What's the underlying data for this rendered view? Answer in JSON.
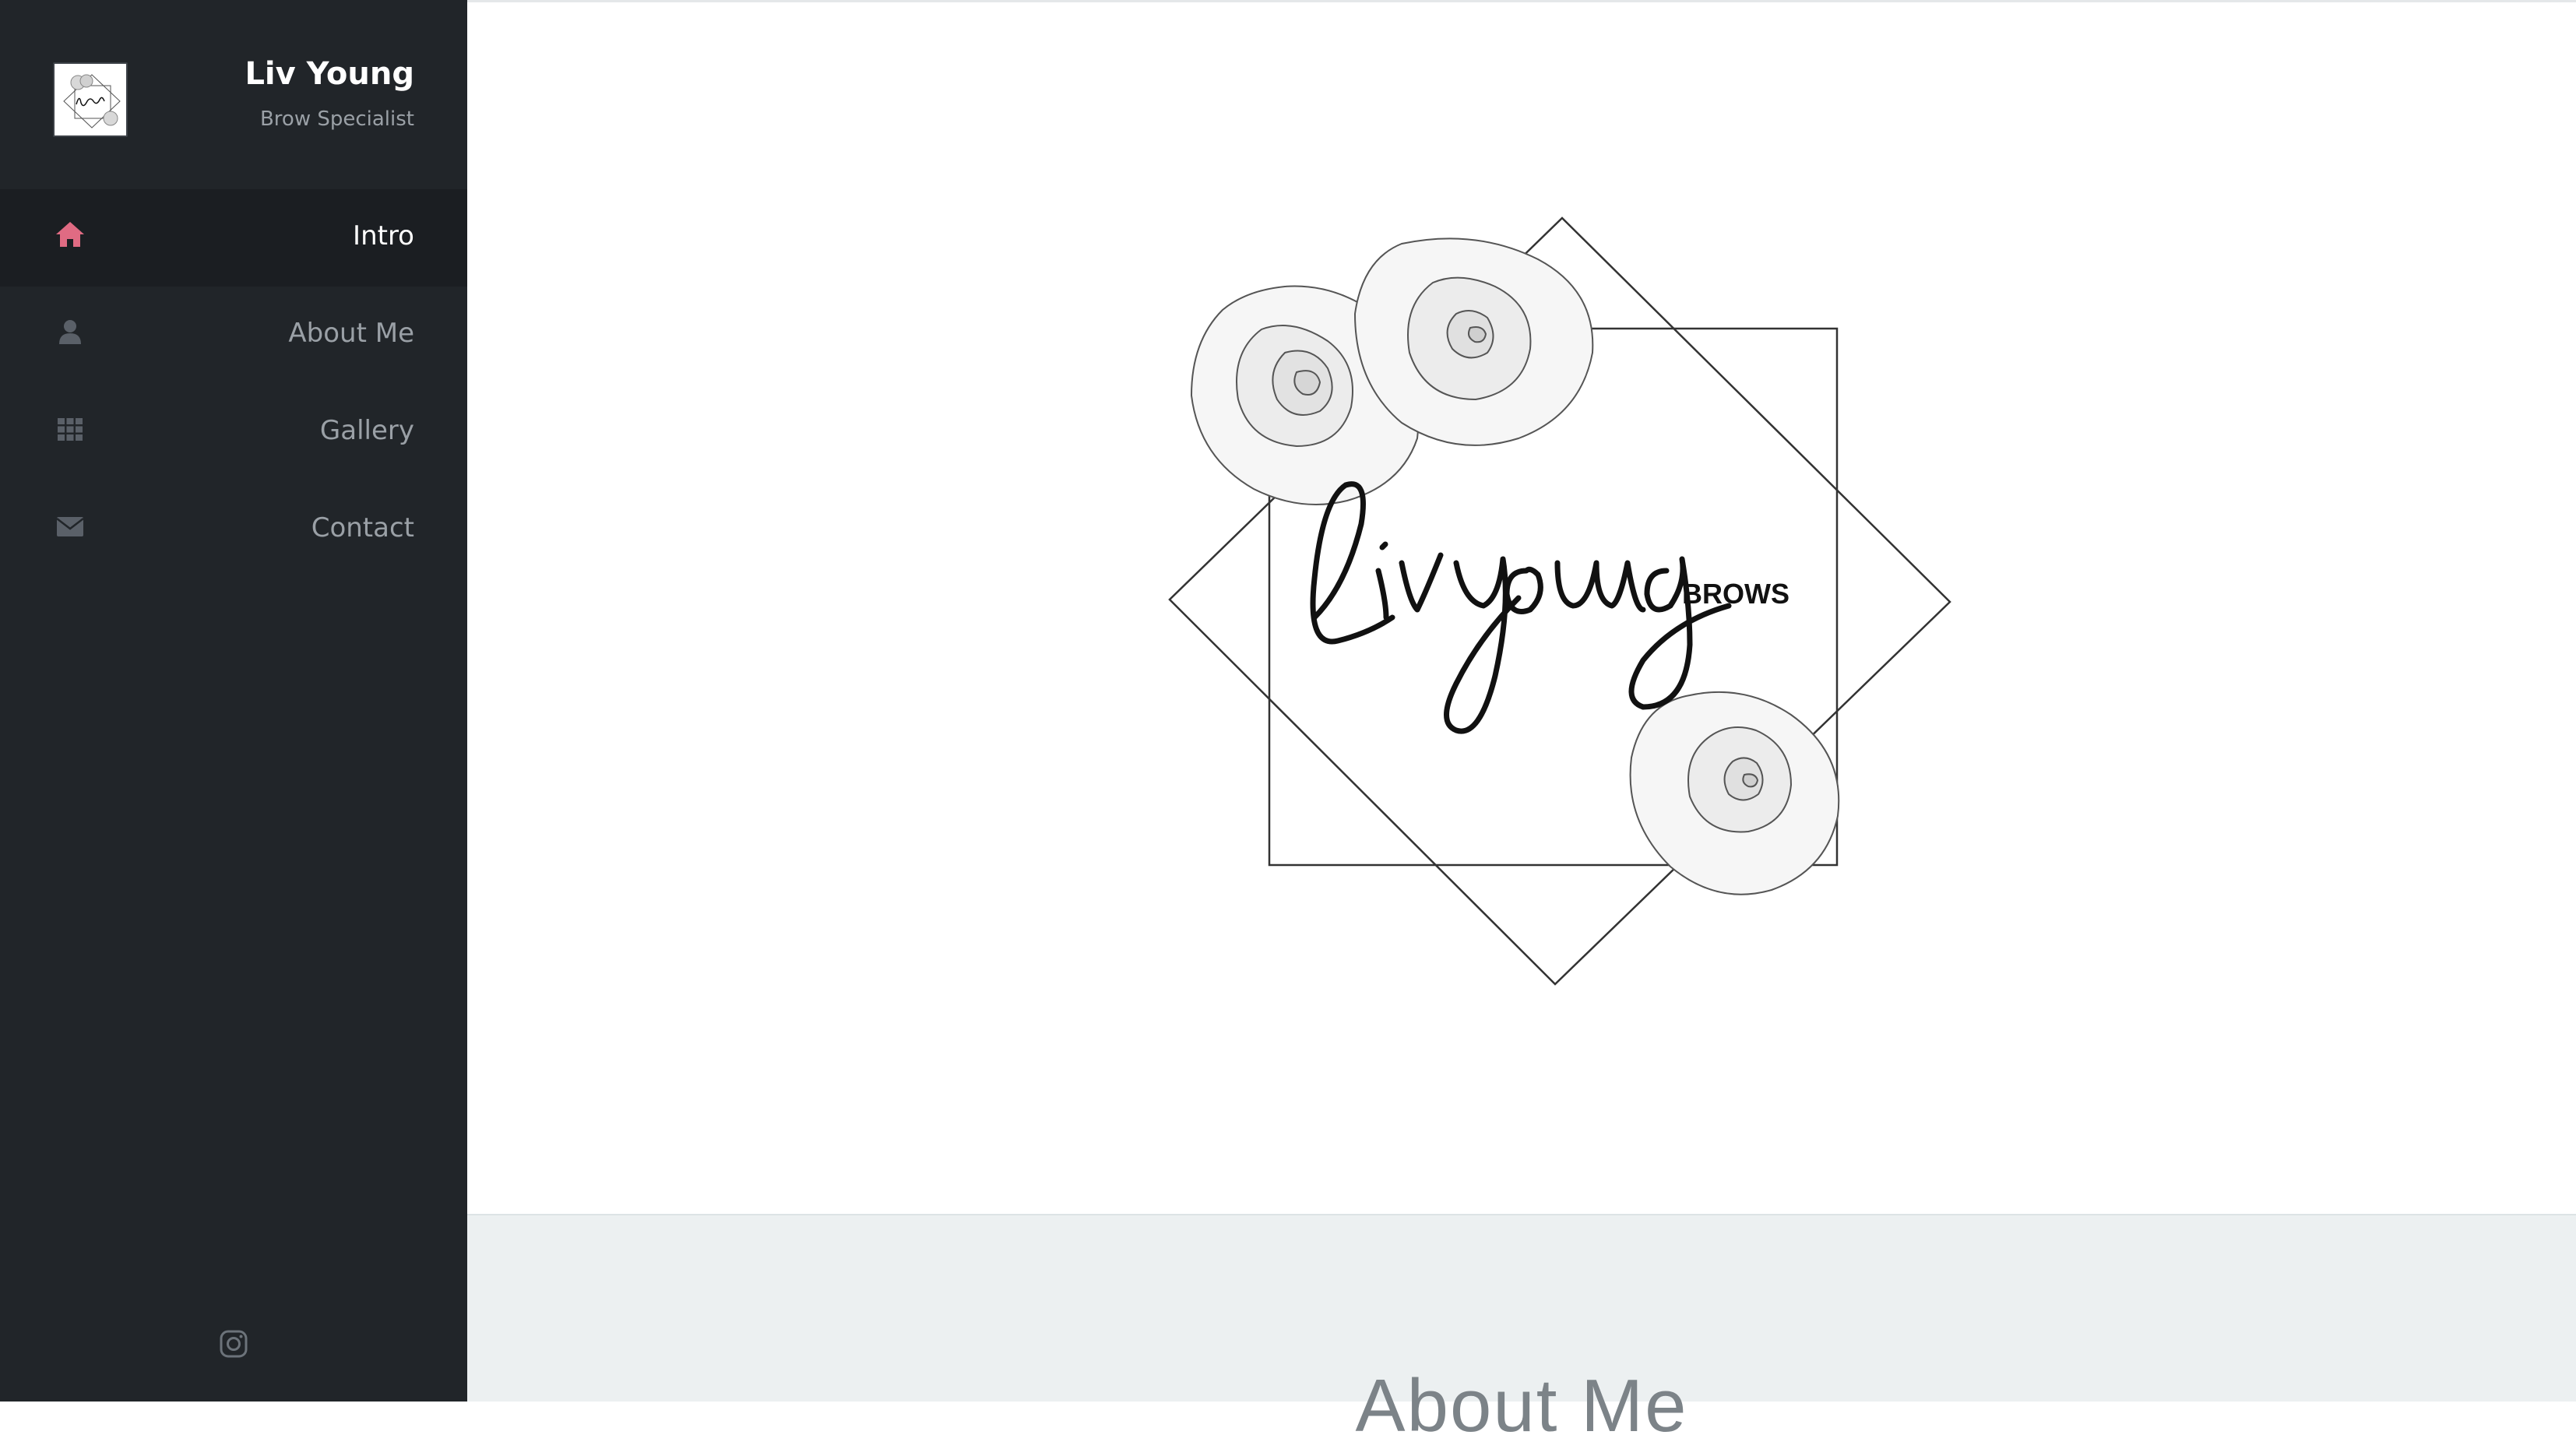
{
  "profile": {
    "name": "Liv Young",
    "title": "Brow Specialist"
  },
  "nav": {
    "items": [
      {
        "label": "Intro",
        "icon": "home-icon",
        "active": true
      },
      {
        "label": "About Me",
        "icon": "user-icon",
        "active": false
      },
      {
        "label": "Gallery",
        "icon": "grid-icon",
        "active": false
      },
      {
        "label": "Contact",
        "icon": "envelope-icon",
        "active": false
      }
    ]
  },
  "social": {
    "icon": "instagram-icon"
  },
  "intro": {
    "logo_script": "Liv young",
    "logo_word": "BROWS"
  },
  "about": {
    "heading": "About Me"
  },
  "colors": {
    "sidebar_bg": "#212529",
    "active_bg": "#1b1e22",
    "accent": "#e06b83",
    "muted_icon": "#5a6068",
    "about_bg": "#ecf0f1"
  }
}
